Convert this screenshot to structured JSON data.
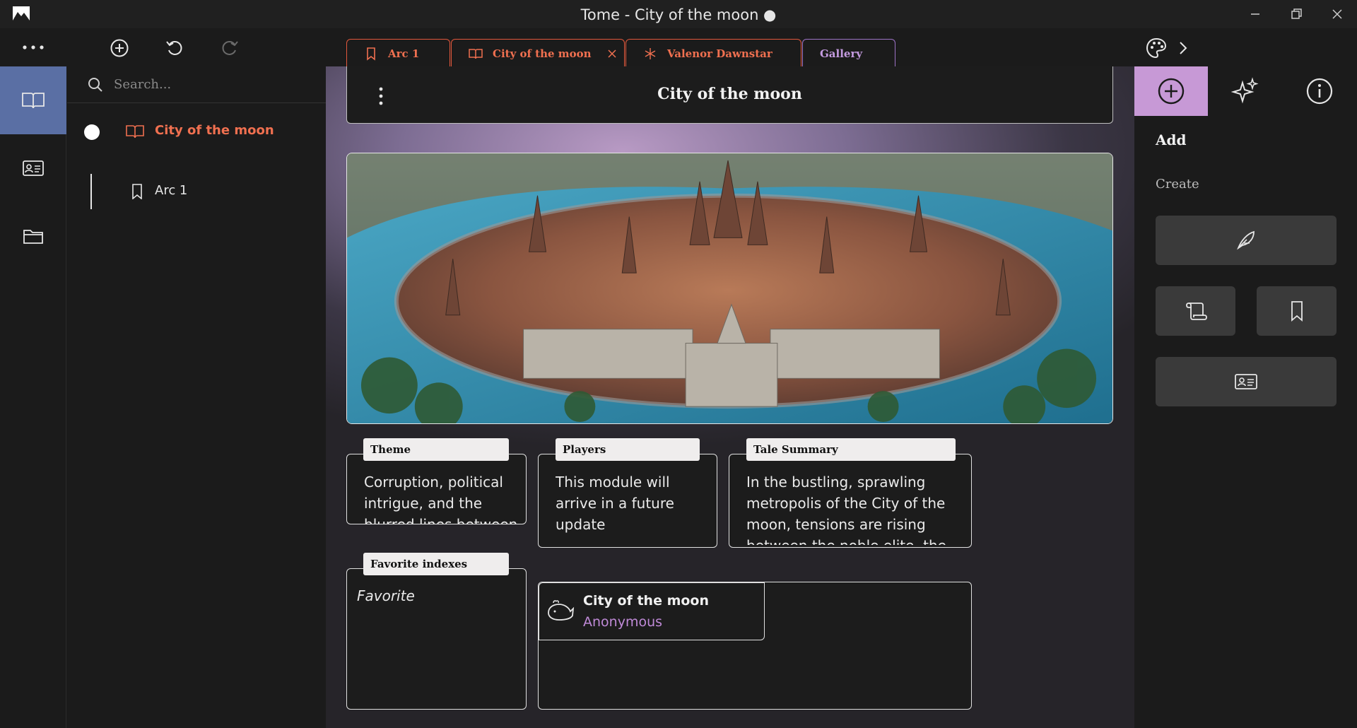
{
  "window": {
    "title": "Tome - City of the moon ●"
  },
  "tabs": [
    {
      "label": "Arc 1",
      "icon": "bookmark-icon"
    },
    {
      "label": "City of the moon",
      "icon": "book-icon"
    },
    {
      "label": "Valenor Dawnstar",
      "icon": "asterisk-icon"
    },
    {
      "label": "Gallery"
    }
  ],
  "explorer": {
    "search_placeholder": "Search...",
    "items": [
      {
        "label": "City of the moon",
        "icon": "book-icon",
        "color": "#f07050"
      },
      {
        "label": "Arc 1",
        "icon": "bookmark-icon",
        "color": "#e6e6e6"
      }
    ]
  },
  "main": {
    "title": "City of the moon",
    "cards": {
      "theme": {
        "label": "Theme",
        "text": "Corruption, political intrigue, and the blurred lines between"
      },
      "players": {
        "label": "Players",
        "text": "This module will arrive in a future update"
      },
      "summary": {
        "label": "Tale Summary",
        "text": "In the bustling, sprawling metropolis of the City of the moon, tensions are rising between the noble elite, the city watch, and the downtrodden underclass. St"
      },
      "favorites": {
        "label": "Favorite indexes",
        "text": "Favorite"
      }
    },
    "linked": {
      "title": "City of the moon",
      "subtitle": "Anonymous",
      "icon": "whale-icon"
    }
  },
  "right_panel": {
    "heading": "Add",
    "subheading": "Create",
    "buttons": [
      "quill-icon",
      "scroll-icon",
      "bookmark-icon",
      "id-card-icon"
    ]
  },
  "colors": {
    "accent_orange": "#f07050",
    "accent_purple": "#c799d6",
    "rail_active": "#5a6fa4"
  }
}
